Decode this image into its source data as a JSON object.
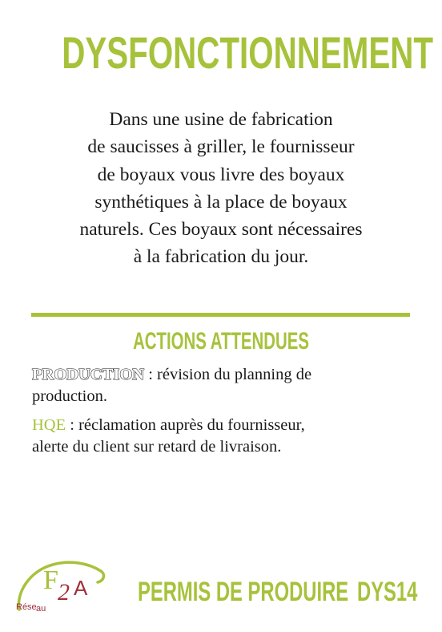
{
  "card": {
    "title": "DYSFONCTIONNEMENT",
    "intro_lines": [
      "Dans une usine de fabrication",
      "de saucisses à griller, le fournisseur",
      "de boyaux vous livre des boyaux",
      "synthétiques à la place de boyaux",
      "naturels. Ces boyaux sont nécessaires",
      "à la fabrication du jour."
    ]
  },
  "actions": {
    "heading": "ACTIONS ATTENDUES",
    "items": [
      {
        "department": "PRODUCTION",
        "line1": " : révision du planning de",
        "line2": "production."
      },
      {
        "department": "HQE",
        "line1": " :  réclamation auprès du fournisseur,",
        "line2": "alerte du client sur retard de livraison."
      }
    ]
  },
  "footer": {
    "logo_text": "Réseau F2A",
    "label": "PERMIS DE PRODUIRE",
    "code": "DYS14"
  },
  "colors": {
    "accent": "#a6c23b",
    "text": "#1a1a1a",
    "logo_red": "#a0303a"
  }
}
